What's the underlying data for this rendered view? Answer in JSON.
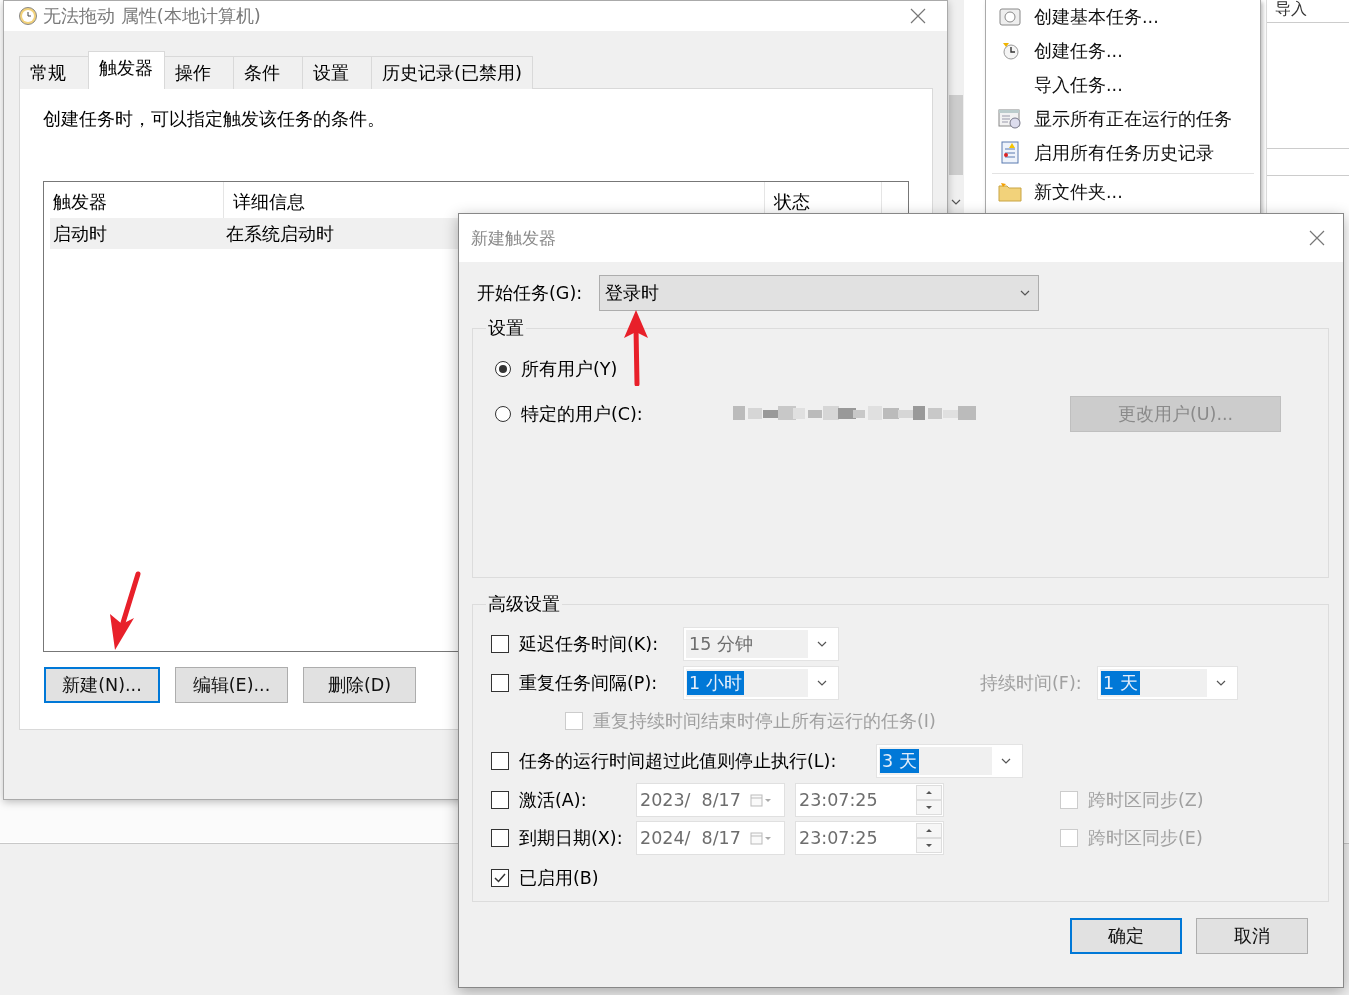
{
  "menu": {
    "items": [
      {
        "label": "创建基本任务...",
        "kind": "wizard",
        "separator_before": false
      },
      {
        "label": "创建任务...",
        "kind": "clock",
        "separator_before": false
      },
      {
        "label": "导入任务...",
        "kind": "none",
        "separator_before": false
      },
      {
        "label": "显示所有正在运行的任务",
        "kind": "running",
        "separator_before": false
      },
      {
        "label": "启用所有任务历史记录",
        "kind": "log",
        "separator_before": false
      },
      {
        "label": "新文件夹...",
        "kind": "folder",
        "separator_before": true
      }
    ]
  },
  "side_panel": {
    "label": "导入"
  },
  "properties_window": {
    "title": "无法拖动 属性(本地计算机)",
    "tabs": [
      {
        "label": "常规",
        "selected": false
      },
      {
        "label": "触发器",
        "selected": true
      },
      {
        "label": "操作",
        "selected": false
      },
      {
        "label": "条件",
        "selected": false
      },
      {
        "label": "设置",
        "selected": false
      },
      {
        "label": "历史记录(已禁用)",
        "selected": false
      }
    ],
    "description": "创建任务时，可以指定触发该任务的条件。",
    "table": {
      "columns": [
        "触发器",
        "详细信息",
        "状态"
      ],
      "rows": [
        {
          "cells": [
            "启动时",
            "在系统启动时"
          ],
          "selected": true
        }
      ]
    },
    "buttons": [
      {
        "label": "新建(N)...",
        "focused": true
      },
      {
        "label": "编辑(E)...",
        "focused": false
      },
      {
        "label": "删除(D)",
        "focused": false
      }
    ]
  },
  "trigger_dialog": {
    "title": "新建触发器",
    "begin_task": {
      "label": "开始任务(G):",
      "value": "登录时"
    },
    "settings": {
      "title": "设置",
      "options": [
        {
          "label": "所有用户(Y)",
          "selected": true
        },
        {
          "label": "特定的用户(C):",
          "selected": false
        }
      ],
      "change_user_button": {
        "label": "更改用户(U)...",
        "disabled": true
      }
    },
    "advanced": {
      "title": "高级设置",
      "delay": {
        "label": "延迟任务时间(K):",
        "checked": false,
        "disabled": false,
        "dropdown": {
          "value": "15 分钟",
          "disabled": true,
          "highlighted": false
        }
      },
      "repeat": {
        "label": "重复任务间隔(P):",
        "checked": false,
        "disabled": false,
        "dropdown": {
          "value": "1 小时",
          "disabled": true,
          "highlighted": true
        },
        "duration_label": "持续时间(F):",
        "duration_dropdown": {
          "value": "1 天",
          "disabled": true,
          "highlighted": true
        }
      },
      "stop_at_end": {
        "label": "重复持续时间结束时停止所有运行的任务(I)",
        "checked": false,
        "disabled": true
      },
      "stop_after": {
        "label": "任务的运行时间超过此值则停止执行(L):",
        "checked": false,
        "disabled": false,
        "dropdown": {
          "value": "3 天",
          "disabled": true,
          "highlighted": true
        }
      },
      "activate": {
        "label": "激活(A):",
        "checked": false,
        "disabled": false,
        "date": "2023/  8/17",
        "time": "23:07:25",
        "sync": {
          "label": "跨时区同步(Z)",
          "checked": false,
          "disabled": true
        }
      },
      "expire": {
        "label": "到期日期(X):",
        "checked": false,
        "disabled": false,
        "date": "2024/  8/17",
        "time": "23:07:25",
        "sync": {
          "label": "跨时区同步(E)",
          "checked": false,
          "disabled": true
        }
      },
      "enabled": {
        "label": "已启用(B)",
        "checked": true,
        "disabled": false
      }
    },
    "buttons": [
      {
        "label": "确定",
        "focused": true
      },
      {
        "label": "取消",
        "focused": false
      }
    ]
  }
}
